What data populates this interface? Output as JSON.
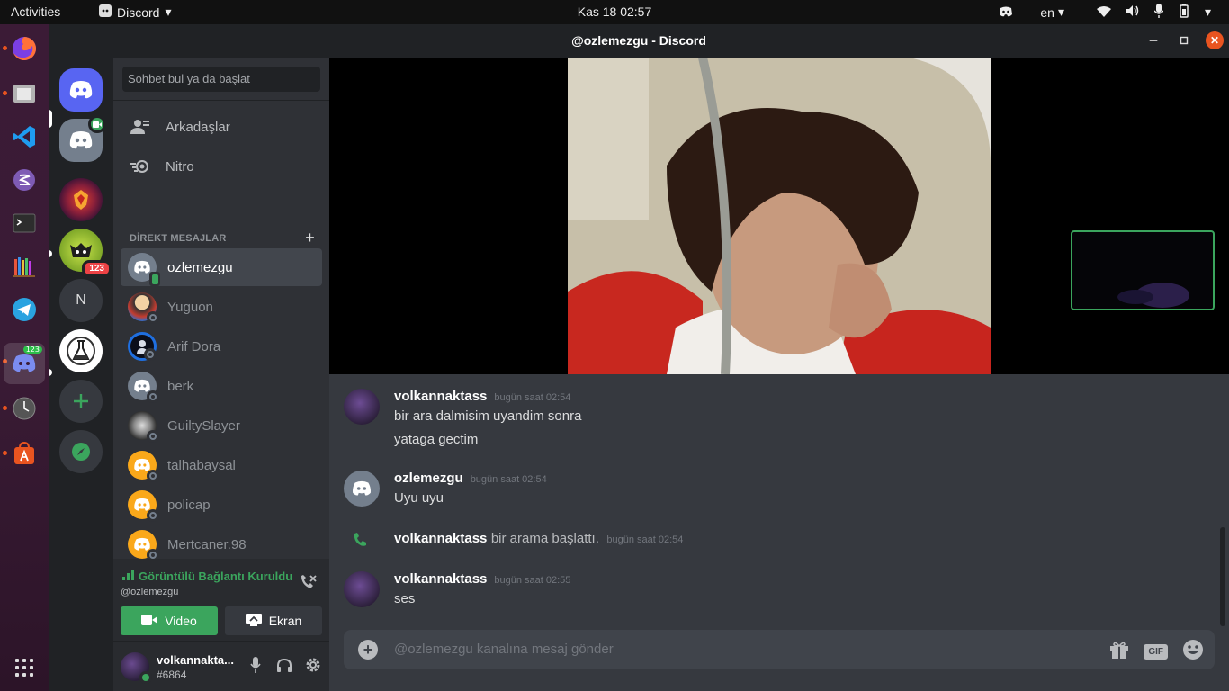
{
  "topbar": {
    "activities": "Activities",
    "app_name": "Discord",
    "clock": "Kas 18  02:57",
    "lang": "en"
  },
  "window": {
    "title": "@ozlemezgu - Discord"
  },
  "servers": {
    "badge_count": "123",
    "n_label": "N"
  },
  "dock": {
    "discord_badge": "123"
  },
  "sidebar": {
    "search_placeholder": "Sohbet bul ya da başlat",
    "nav": [
      {
        "label": "Arkadaşlar",
        "icon": "friends-icon"
      },
      {
        "label": "Nitro",
        "icon": "nitro-icon"
      }
    ],
    "dm_header": "DİREKT MESAJLAR",
    "dms": [
      {
        "name": "ozlemezgu",
        "status": "mobile-online",
        "selected": true
      },
      {
        "name": "Yuguon",
        "status": "offline"
      },
      {
        "name": "Arif Dora",
        "status": "offline"
      },
      {
        "name": "berk",
        "status": "offline"
      },
      {
        "name": "GuiltySlayer",
        "status": "offline"
      },
      {
        "name": "talhabaysal",
        "status": "offline"
      },
      {
        "name": "policap",
        "status": "offline"
      },
      {
        "name": "Mertcaner.98",
        "status": "offline"
      }
    ]
  },
  "voice": {
    "status": "Görüntülü Bağlantı Kuruldu",
    "channel": "@ozlemezgu",
    "video_label": "Video",
    "screen_label": "Ekran"
  },
  "user": {
    "name": "volkannakta...",
    "tag": "#6864"
  },
  "messages": [
    {
      "author": "volkannaktass",
      "time": "bugün saat 02:54",
      "lines": [
        "bir ara dalmisim uyandim sonra",
        "yataga gectim"
      ]
    },
    {
      "author": "ozlemezgu",
      "time": "bugün saat 02:54",
      "lines": [
        "Uyu uyu"
      ]
    },
    {
      "author": "volkannaktass",
      "system_text": "bir arama başlattı.",
      "time": "bugün saat 02:54"
    },
    {
      "author": "volkannaktass",
      "time": "bugün saat 02:55",
      "lines": [
        "ses"
      ]
    }
  ],
  "composer": {
    "placeholder": "@ozlemezgu kanalına mesaj gönder",
    "gif": "GIF"
  },
  "colors": {
    "blurple": "#5865f2",
    "green": "#3ba55d",
    "red": "#ed4245",
    "ubuntu_orange": "#e95420"
  }
}
